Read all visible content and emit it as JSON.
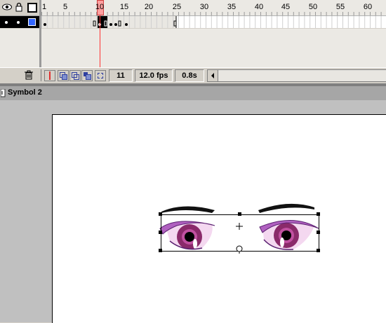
{
  "timeline": {
    "header_icons": [
      "eye-icon",
      "lock-icon",
      "outline-square-icon"
    ],
    "ruler_labels": [
      "1",
      "5",
      "10",
      "15",
      "20",
      "25",
      "30",
      "35",
      "40",
      "45",
      "50",
      "55",
      "60"
    ],
    "current_frame_marker": "10",
    "layer_color": "#3366ff",
    "playhead_color": "#ff3333"
  },
  "status": {
    "current_frame": "11",
    "fps": "12.0 fps",
    "elapsed": "0.8s"
  },
  "edit_bar": {
    "symbol_name": "Symbol 2"
  },
  "colors": {
    "eye_iris": "#8a2a6a",
    "eye_lid": "#b060c0",
    "brow": "#111111"
  }
}
